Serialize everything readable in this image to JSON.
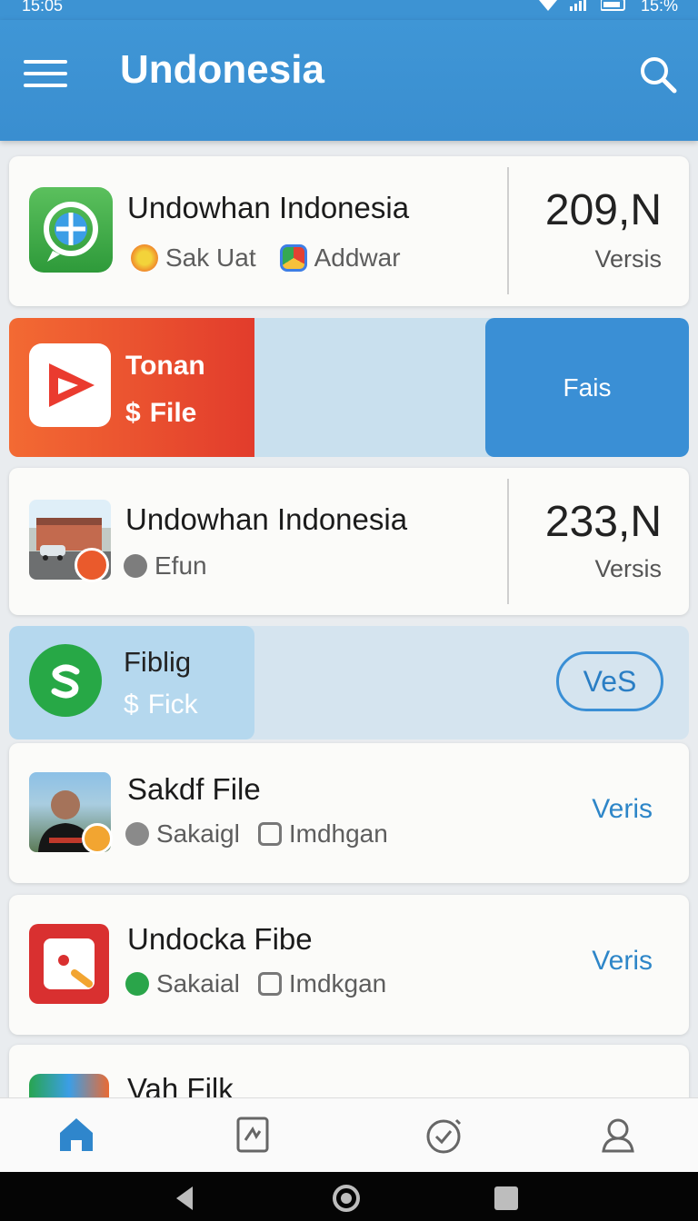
{
  "status_bar": {
    "time": "15:05",
    "battery": "15:%"
  },
  "header": {
    "title": "Undonesia"
  },
  "cards": [
    {
      "title": "Undowhan Indonesia",
      "sub1": "Sak Uat",
      "sub2": "Addwar",
      "count": "209,N",
      "count_label": "Versis"
    },
    {
      "title": "Tonan",
      "subtitle": "File",
      "action": "Fais"
    },
    {
      "title": "Undowhan Indonesia",
      "sub1": "Efun",
      "count": "233,N",
      "count_label": "Versis"
    },
    {
      "title": "Fiblig",
      "subtitle": "Fick",
      "action": "VeS"
    },
    {
      "title": "Sakdf File",
      "sub1": "Sakaigl",
      "sub2": "Imdhgan",
      "action": "Veris"
    },
    {
      "title": "Undocka Fibe",
      "sub1": "Sakaial",
      "sub2": "Imdkgan",
      "action": "Veris"
    },
    {
      "title": "Vah Filk"
    }
  ],
  "colors": {
    "primary": "#3d93d3",
    "link": "#2e86c8",
    "nav_active": "#2f86cc"
  },
  "bottom_nav": [
    "home-icon",
    "file-icon",
    "clock-icon",
    "profile-icon"
  ]
}
